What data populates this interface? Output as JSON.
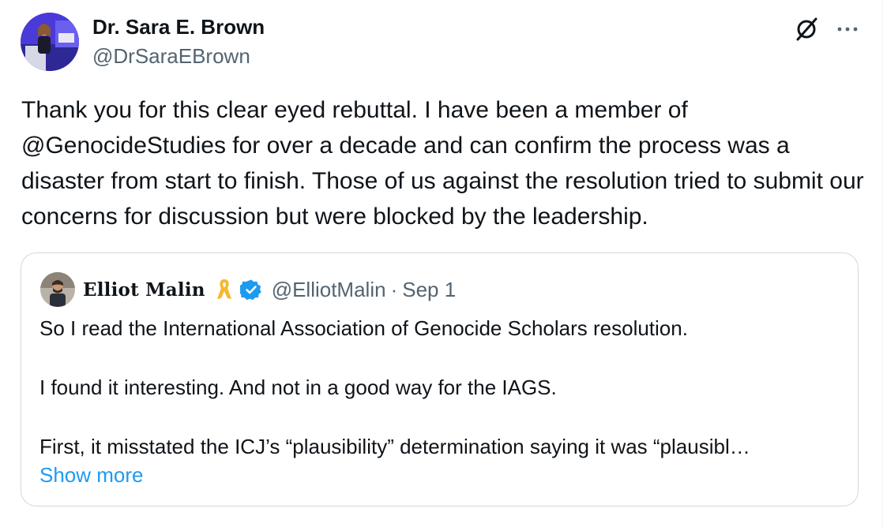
{
  "post": {
    "author_name": "Dr. Sara E. Brown",
    "author_handle": "@DrSaraEBrown",
    "text": "Thank you for this clear eyed rebuttal. I have been a member of @GenocideStudies for over a decade and can confirm the process was a disaster from start to finish. Those of us against the resolution tried to submit our concerns for discussion but were blocked by the leadership."
  },
  "icons": {
    "grok": "grok-icon",
    "more": "more-options-icon",
    "ribbon": "yellow-ribbon-icon",
    "verified": "verified-badge-icon"
  },
  "quote": {
    "author_name": "Elliot Malin",
    "author_handle": "@ElliotMalin",
    "separator": "·",
    "date": "Sep 1",
    "lines": [
      "So I read the International Association of Genocide Scholars resolution.",
      "I found it interesting. And not in a good way for the IAGS.",
      "First, it misstated the ICJ’s “plausibility” determination saying it was “plausibl…"
    ],
    "show_more": "Show more"
  },
  "colors": {
    "text": "#0f1419",
    "secondary": "#536471",
    "link": "#1d9bf0",
    "border": "#cfd9de",
    "ribbon": "#f5b82e",
    "verified": "#1d9bf0"
  }
}
